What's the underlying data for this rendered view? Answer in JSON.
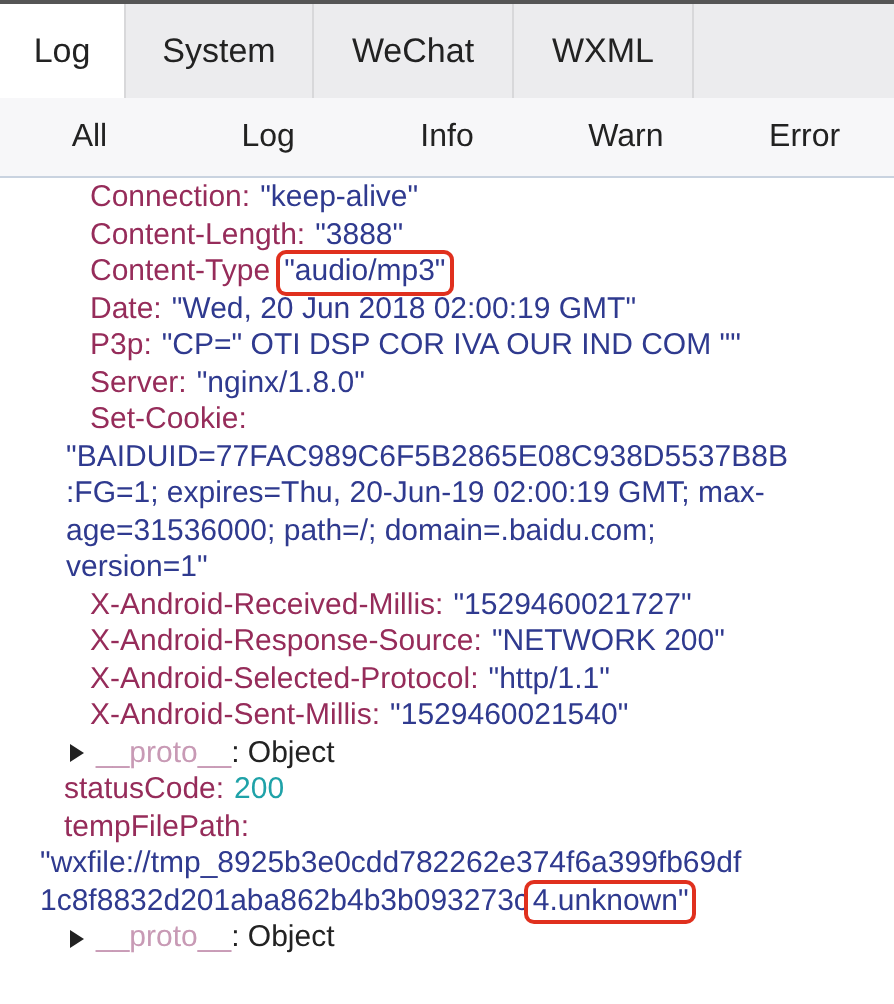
{
  "tabs": [
    {
      "label": "Log",
      "selected": true
    },
    {
      "label": "System",
      "selected": false
    },
    {
      "label": "WeChat",
      "selected": false
    },
    {
      "label": "WXML",
      "selected": false
    }
  ],
  "filters": [
    "All",
    "Log",
    "Info",
    "Warn",
    "Error"
  ],
  "entries": [
    {
      "kind": "group",
      "children": [
        {
          "kind": "string_field",
          "key": "Connection:",
          "value": "\"keep-alive\"",
          "highlighted": false
        },
        {
          "kind": "string_field",
          "key": "Content-Length:",
          "value": "\"3888\"",
          "highlighted": false
        },
        {
          "kind": "string_field",
          "key": "Content-Type",
          "value": "\"audio/mp3\"",
          "highlighted": true
        },
        {
          "kind": "string_field",
          "key": "Date:",
          "value": "\"Wed, 20 Jun 2018 02:00:19 GMT\"",
          "highlighted": false
        },
        {
          "kind": "string_field",
          "key": "P3p:",
          "value": "\"CP=\" OTI DSP COR IVA OUR IND COM \"\"",
          "highlighted": false
        },
        {
          "kind": "string_field",
          "key": "Server:",
          "value": "\"nginx/1.8.0\"",
          "highlighted": false
        },
        {
          "kind": "wrapped",
          "key": "Set-Cookie:",
          "value_lines": [
            {
              "text": "\"BAIDUID=77FAC989C6F5B2865E08C938D5537B8B",
              "highlighted": false
            },
            {
              "text": ":FG=1; expires=Thu, 20-Jun-19 02:00:19 GMT; max-",
              "highlighted": false
            },
            {
              "text": "age=31536000; path=/; domain=.baidu.com;",
              "highlighted": false
            },
            {
              "text": "version=1\"",
              "highlighted": false
            }
          ]
        },
        {
          "kind": "string_field",
          "key": "X-Android-Received-Millis:",
          "value": "\"1529460021727\"",
          "highlighted": false
        },
        {
          "kind": "string_field",
          "key": "X-Android-Response-Source:",
          "value": "\"NETWORK 200\"",
          "highlighted": false
        },
        {
          "kind": "string_field",
          "key": "X-Android-Selected-Protocol:",
          "value": "\"http/1.1\"",
          "highlighted": false
        },
        {
          "kind": "string_field",
          "key": "X-Android-Sent-Millis:",
          "value": "\"1529460021540\"",
          "highlighted": false
        }
      ]
    },
    {
      "kind": "proto",
      "key": "__proto__",
      "value": ": Object",
      "expanded": false
    },
    {
      "kind": "number_field",
      "key": "statusCode:",
      "value": "200",
      "highlighted": false
    },
    {
      "kind": "wrapped",
      "key": "tempFilePath:",
      "value_lines": [
        {
          "text": "\"wxfile://tmp_8925b3e0cdd782262e374f6a399fb69df",
          "highlighted": false
        },
        {
          "text": "1c8f8832d201aba862b4b3b093273c",
          "highlighted": false
        },
        {
          "text": "4.unknown\"",
          "highlighted": true
        }
      ]
    },
    {
      "kind": "proto",
      "key": "__proto__",
      "value": ": Object",
      "expanded": false
    }
  ]
}
